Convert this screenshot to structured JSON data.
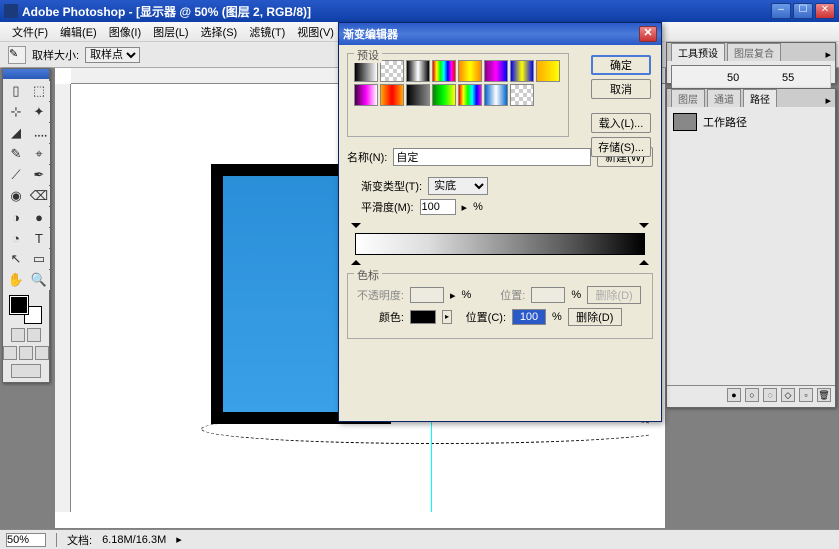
{
  "app": {
    "title": "Adobe Photoshop - [显示器 @ 50% (图层 2, RGB/8)]"
  },
  "menu": [
    "文件(F)",
    "编辑(E)",
    "图像(I)",
    "图层(L)",
    "选择(S)",
    "滤镜(T)",
    "视图(V)",
    "窗口(W)",
    "帮助(H)"
  ],
  "options": {
    "sample_label": "取样大小:",
    "sample_value": "取样点"
  },
  "status": {
    "zoom": "50%",
    "doc_label": "文档:",
    "doc_size": "6.18M/16.3M"
  },
  "dialog": {
    "title": "渐变编辑器",
    "presets_label": "预设",
    "buttons": {
      "ok": "确定",
      "cancel": "取消",
      "load": "载入(L)...",
      "save": "存储(S)...",
      "new": "新建(W)"
    },
    "name_label": "名称(N):",
    "name_value": "自定",
    "type_label": "渐变类型(T):",
    "type_value": "实底",
    "smooth_label": "平滑度(M):",
    "smooth_value": "100",
    "percent": "%",
    "stops_label": "色标",
    "opacity_label": "不透明度:",
    "position_label": "位置:",
    "position2_label": "位置(C):",
    "position2_value": "100",
    "color_label": "颜色:",
    "delete": "删除(D)"
  },
  "panels": {
    "navigator": {
      "tabs": [
        "工具预设",
        "图层复合"
      ]
    },
    "paths": {
      "tabs": [
        "图层",
        "通道",
        "路径"
      ],
      "active_tab": 2,
      "item": "工作路径"
    }
  },
  "presets": [
    "linear-gradient(to right,#000,#fff)",
    "repeating-conic-gradient(#ccc 0 25%,#fff 0 50%) 0 0/8px 8px",
    "linear-gradient(to right,#000,#fff,#000)",
    "linear-gradient(to right,#f00,#ff0,#0f0,#0ff,#00f,#f0f,#f00)",
    "linear-gradient(to right,#f80,#ff0,#f80)",
    "linear-gradient(to right,#808,#f0f,#00f)",
    "linear-gradient(to right,#00f,#ff0,#00f)",
    "linear-gradient(to right,#fa0,#ff0)",
    "linear-gradient(to right,#404,#f0f,#fff)",
    "linear-gradient(to right,#fa0,#f00,#fa0)",
    "linear-gradient(to right,#000,#888)",
    "linear-gradient(to right,#080,#0f0,#ff0)",
    "linear-gradient(to right,#f00,#ff0,#0f0,#0ff,#00f,#f0f)",
    "linear-gradient(to right,#06c,#fff,#06c)",
    "repeating-conic-gradient(#ccc 0 25%,#fff 0 50%) 0 0/8px 8px"
  ],
  "tools": [
    "▯",
    "⬚",
    "⊹",
    "✦",
    "◢",
    "᠁",
    "✎",
    "⌖",
    "⟋",
    "✒",
    "◉",
    "⌫",
    "◑",
    "●",
    "◔",
    "T",
    "↖",
    "▭",
    "✋",
    "🔍"
  ]
}
